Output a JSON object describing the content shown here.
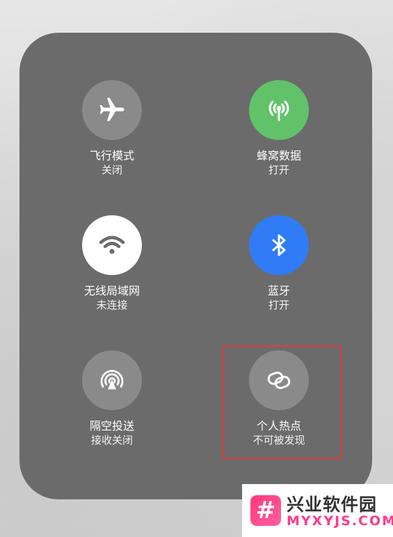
{
  "toggles": [
    {
      "icon": "airplane-icon",
      "title": "飞行模式",
      "status": "关闭",
      "color": "#8a8a8a"
    },
    {
      "icon": "cellular-antenna-icon",
      "title": "蜂窝数据",
      "status": "打开",
      "color": "#61c26a"
    },
    {
      "icon": "wifi-icon",
      "title": "无线局域网",
      "status": "未连接",
      "color": "#ffffff"
    },
    {
      "icon": "bluetooth-icon",
      "title": "蓝牙",
      "status": "打开",
      "color": "#2f7cf6"
    },
    {
      "icon": "airdrop-icon",
      "title": "隔空投送",
      "status": "接收关闭",
      "color": "#8a8a8a"
    },
    {
      "icon": "personal-hotspot-icon",
      "title": "个人热点",
      "status": "不可被发现",
      "color": "#8a8a8a"
    }
  ],
  "highlight": {
    "color": "#e23a3a"
  },
  "watermark": {
    "logo_glyph": "#",
    "name": "兴业软件园",
    "url": "MYXYJS.COM"
  }
}
